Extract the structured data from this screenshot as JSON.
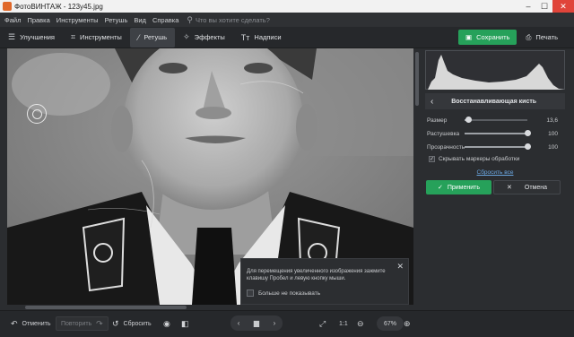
{
  "window": {
    "title": "ФотоВИНТАЖ - 123y45.jpg",
    "controls": [
      "–",
      "☐",
      "✕"
    ]
  },
  "menu": {
    "items": [
      "Файл",
      "Правка",
      "Инструменты",
      "Ретушь",
      "Вид",
      "Справка"
    ],
    "search_placeholder": "Что вы хотите сделать?"
  },
  "toolbar": {
    "tabs": [
      {
        "label": "Улучшения",
        "icon": "enhance-icon"
      },
      {
        "label": "Инструменты",
        "icon": "crop-icon"
      },
      {
        "label": "Ретушь",
        "icon": "brush-icon",
        "active": true
      },
      {
        "label": "Эффекты",
        "icon": "magic-wand-icon"
      },
      {
        "label": "Надписи",
        "icon": "text-icon"
      }
    ],
    "save_label": "Сохранить",
    "print_label": "Печать"
  },
  "notice": {
    "text": "Для перемещения увеличенного изображения зажмите клавишу Пробел и левую кнопку мыши.",
    "checkbox_label": "Больше не показывать"
  },
  "panel": {
    "title": "Восстанавливающая кисть",
    "sliders": [
      {
        "label": "Размер",
        "value": "13,6",
        "level": 0.06
      },
      {
        "label": "Растушевка",
        "value": "100",
        "level": 1.0
      },
      {
        "label": "Прозрачность",
        "value": "100",
        "level": 1.0
      }
    ],
    "hide_markers_label": "Скрывать маркеры обработки",
    "reset_all_label": "Сбросить все",
    "apply_label": "Применить",
    "cancel_label": "Отмена"
  },
  "bottom": {
    "undo_label": "Отменить",
    "redo_label": "Повторить",
    "reset_label": "Сбросить",
    "zoom_ratio_label": "1:1",
    "zoom_percent": "67%"
  },
  "colors": {
    "accent_green": "#26a15a",
    "close_red": "#e0443a",
    "link_blue": "#6aa6e0"
  }
}
